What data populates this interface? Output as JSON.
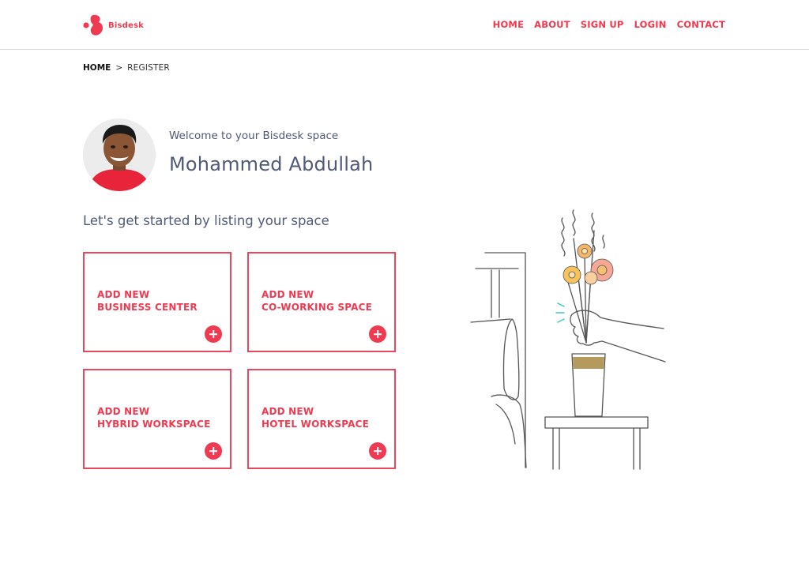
{
  "brand": {
    "name": "Bisdesk",
    "accent": "#ef3a51",
    "text_color": "#4f5a78"
  },
  "nav": {
    "items": [
      "HOME",
      "ABOUT",
      "SIGN UP",
      "LOGIN",
      "CONTACT"
    ]
  },
  "breadcrumb": {
    "home": "HOME",
    "separator": ">",
    "current": "REGISTER"
  },
  "profile": {
    "welcome": "Welcome to your Bisdesk space",
    "name": "Mohammed Abdullah"
  },
  "main": {
    "subtitle": "Let's get started by listing your space",
    "cards": [
      {
        "line1": "ADD NEW",
        "line2": "BUSINESS CENTER",
        "icon": "plus-icon"
      },
      {
        "line1": "ADD NEW",
        "line2": "CO-WORKING SPACE",
        "icon": "plus-icon"
      },
      {
        "line1": "ADD NEW",
        "line2": "HYBRID WORKSPACE",
        "icon": "plus-icon"
      },
      {
        "line1": "ADD NEW",
        "line2": "HOTEL WORKSPACE",
        "icon": "plus-icon"
      }
    ]
  }
}
